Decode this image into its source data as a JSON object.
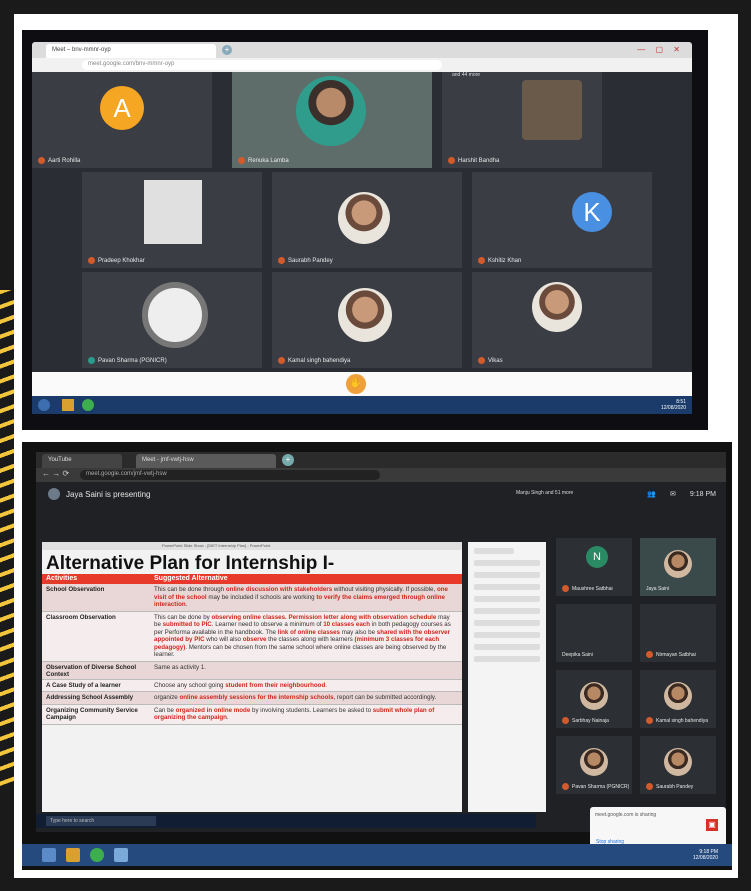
{
  "photo1": {
    "tab_title": "Meet – bnv-mmnr-oyp",
    "url": "meet.google.com/bnv-mmnr-oyp",
    "participants_badge": "and 44 more",
    "participants": [
      {
        "name": "Aarti Rohilla",
        "avatar_letter": "A",
        "avatar_color": "#f5a623"
      },
      {
        "name": "Renuka Lamba"
      },
      {
        "name": "Harshit Bandha"
      },
      {
        "name": "Pradeep Khokhar"
      },
      {
        "name": "Saurabh Pandey"
      },
      {
        "name": "Kshitiz Khan",
        "avatar_letter": "K",
        "avatar_color": "#4a90e2"
      },
      {
        "name": "Pavan Sharma (PGNICR)"
      },
      {
        "name": "Kamal singh bahendiya"
      },
      {
        "name": "Vikas"
      }
    ],
    "clock_time": "8:51",
    "clock_date": "12/08/2020"
  },
  "photo2": {
    "tab_label": "YouTube",
    "tab_title": "Meet - jmf-vwtj-hsw",
    "url": "meet.google.com/jmf-vwtj-hsw",
    "presenting_text": "Jaya Saini is presenting",
    "people_text": "Manju Singh and 51 more",
    "time": "9:18 PM",
    "slide_window_title": "PowerPoint Slide Show - [DIET Internship Plan] - PowerPoint",
    "slide": {
      "title": "Alternative Plan for Internship I-",
      "col_activity": "Activities",
      "col_alternative": "Suggested Alternative",
      "rows": [
        {
          "activity": "School Observation",
          "alternative_parts": [
            "This can be done through ",
            "online discussion with stakeholders",
            " without visiting physically. If possible, ",
            "one visit of the school",
            " may be included if schools are working ",
            "to verify the claims emerged through online interaction",
            "."
          ]
        },
        {
          "activity": "Classroom Observation",
          "alternative_parts": [
            "This can be done by ",
            "observing online classes. Permission letter along with observation schedule",
            " may be ",
            "submitted to PIC",
            ". Learner need to observe a minimum of ",
            "10 classes each",
            " in both pedagogy courses as per Performa available in the handbook. The ",
            "link of online classes",
            " may also be ",
            "shared with the observer appointed by PIC",
            " who will also ",
            "observe",
            " the classes along with learners ",
            "(minimum 3 classes for each pedagogy)",
            ". Mentors can be chosen from the same school where online classes are being observed by the learner."
          ]
        },
        {
          "activity": "Observation of Diverse School Context",
          "alternative_parts": [
            "Same as activity 1."
          ]
        },
        {
          "activity": "A Case Study of a learner",
          "alternative_parts": [
            "Choose any school going ",
            "student from their neighbourhood",
            "."
          ]
        },
        {
          "activity": "Addressing School Assembly",
          "alternative_parts": [
            "organize ",
            "online assembly sessions for the internship schools",
            ", report can be submitted accordingly."
          ]
        },
        {
          "activity": "Organizing Community Service Campaign",
          "alternative_parts": [
            "Can be ",
            "organized in online mode",
            " by involving students. Learners be asked to ",
            "submit whole plan of organizing the campaign",
            "."
          ]
        }
      ]
    },
    "tiles": [
      {
        "name": "Maushree Satbhai",
        "avatar_letter": "N"
      },
      {
        "name": "Jaya Saini"
      },
      {
        "name": "Deepika Saini"
      },
      {
        "name": "Nirmayan Satbhai"
      },
      {
        "name": "Sarbhay Nainaja"
      },
      {
        "name": "Kamal singh bahendiya"
      },
      {
        "name": "Pavan Sharma (PGNICR)"
      },
      {
        "name": "Saurabh Pandey"
      }
    ],
    "toast_title": "meet.google.com is sharing",
    "toast_button": "Stop sharing",
    "search_placeholder": "Type here to search",
    "clock_time": "9:18 PM",
    "clock_date": "12/08/2020"
  }
}
